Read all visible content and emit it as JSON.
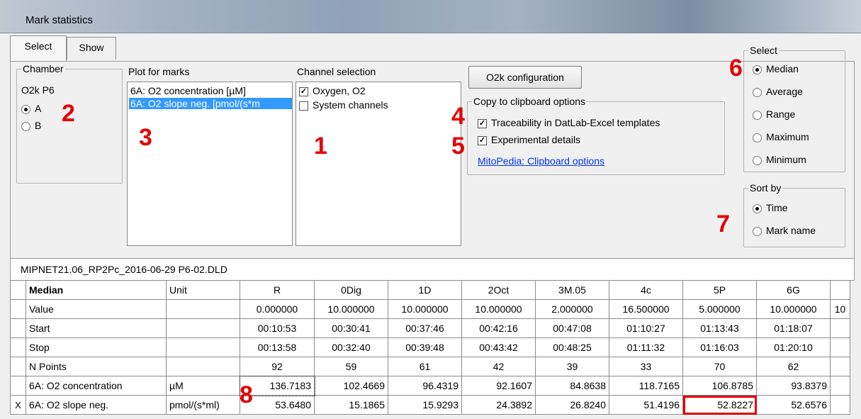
{
  "window": {
    "title": "Mark statistics"
  },
  "tabs": [
    {
      "label": "Select",
      "active": true
    },
    {
      "label": "Show",
      "active": false
    }
  ],
  "chamber": {
    "legend": "Chamber",
    "device": "O2k P6",
    "options": [
      "A",
      "B"
    ],
    "selected": "A"
  },
  "plot_for_marks": {
    "label": "Plot for marks",
    "items": [
      "6A: O2 concentration [µM]",
      "6A: O2 slope neg. [pmol/(s*m"
    ],
    "selected_index": 1
  },
  "channel_selection": {
    "label": "Channel selection",
    "items": [
      {
        "label": "Oxygen, O2",
        "checked": true
      },
      {
        "label": "System channels",
        "checked": false
      }
    ]
  },
  "o2k_button": {
    "label": "O2k configuration"
  },
  "clipboard": {
    "legend": "Copy to clipboard options",
    "options": [
      {
        "label": "Traceability in DatLab-Excel templates",
        "checked": true
      },
      {
        "label": "Experimental details",
        "checked": true
      }
    ],
    "link": "MitoPedia: Clipboard options"
  },
  "select_group": {
    "legend": "Select",
    "options": [
      "Median",
      "Average",
      "Range",
      "Maximum",
      "Minimum"
    ],
    "selected": "Median"
  },
  "sort_by": {
    "legend": "Sort by",
    "options": [
      "Time",
      "Mark name"
    ],
    "selected": "Time"
  },
  "annotations": [
    "1",
    "2",
    "3",
    "4",
    "5",
    "6",
    "7",
    "8"
  ],
  "file": {
    "name": "MIPNET21.06_RP2Pc_2016-06-29 P6-02.DLD"
  },
  "grid": {
    "header": [
      "Median",
      "Unit",
      "R",
      "0Dig",
      "1D",
      "2Oct",
      "3M.05",
      "4c",
      "5P",
      "6G",
      ""
    ],
    "rows": [
      {
        "indicator": "",
        "cells": [
          "Value",
          "",
          "0.000000",
          "10.000000",
          "10.000000",
          "10.000000",
          "2.000000",
          "16.500000",
          "5.000000",
          "10.000000",
          "10"
        ]
      },
      {
        "indicator": "",
        "cells": [
          "Start",
          "",
          "00:10:53",
          "00:30:41",
          "00:37:46",
          "00:42:16",
          "00:47:08",
          "01:10:27",
          "01:13:43",
          "01:18:07",
          ""
        ]
      },
      {
        "indicator": "",
        "cells": [
          "Stop",
          "",
          "00:13:58",
          "00:32:40",
          "00:39:48",
          "00:43:42",
          "00:48:25",
          "01:11:32",
          "01:16:03",
          "01:20:10",
          ""
        ]
      },
      {
        "indicator": "",
        "cells": [
          "N Points",
          "",
          "92",
          "59",
          "61",
          "42",
          "39",
          "33",
          "70",
          "62",
          ""
        ]
      },
      {
        "indicator": "",
        "cells": [
          "6A: O2 concentration",
          "µM",
          "136.7183",
          "102.4669",
          "96.4319",
          "92.1607",
          "84.8638",
          "118.7165",
          "106.8785",
          "93.8379",
          ""
        ]
      },
      {
        "indicator": "X",
        "cells": [
          "6A: O2 slope neg.",
          "pmol/(s*ml)",
          "53.6480",
          "15.1865",
          "15.9293",
          "24.3892",
          "26.8240",
          "51.4196",
          "52.8227",
          "52.6576",
          ""
        ]
      }
    ]
  }
}
